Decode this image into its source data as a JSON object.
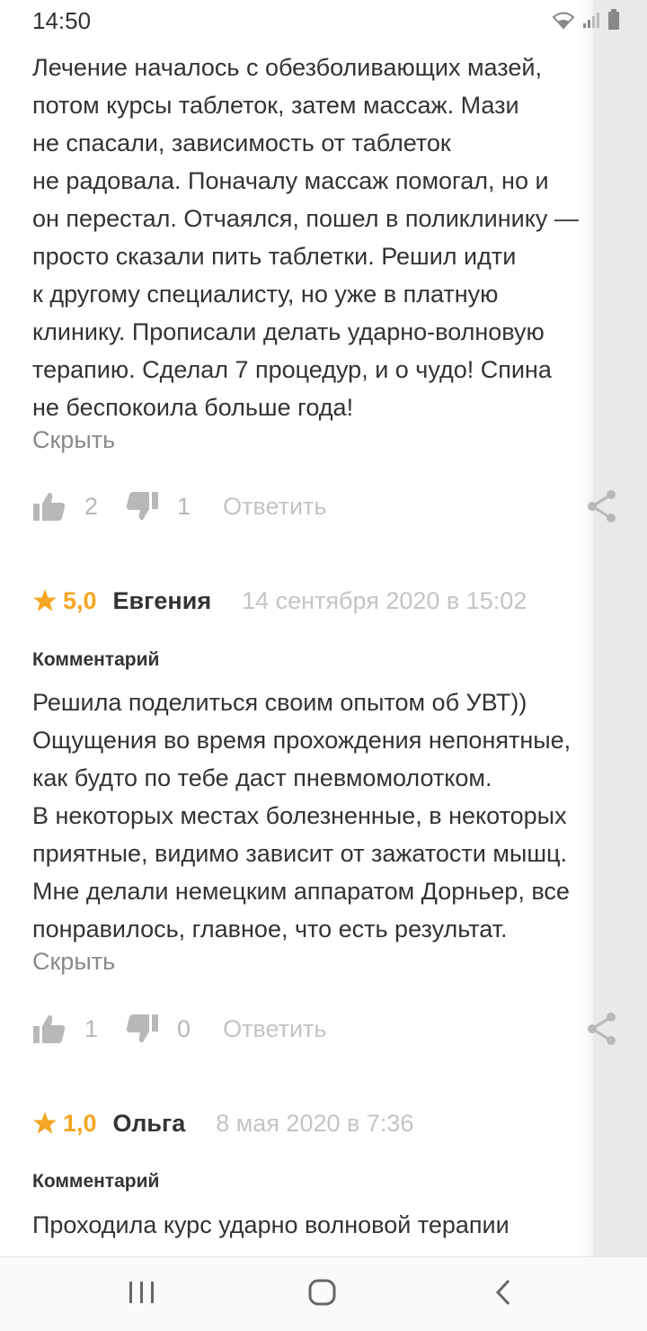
{
  "status_bar": {
    "time": "14:50"
  },
  "review1": {
    "lines": [
      "Лечение началось с обезболивающих мазей,",
      "потом курсы таблеток, затем массаж. Мази",
      "не спасали, зависимость от таблеток",
      "не радовала. Поначалу массаж помогал, но и",
      "он перестал. Отчаялся, пошел в поликлинику —",
      "просто сказали пить таблетки. Решил идти",
      "к другому специалисту, но уже в платную",
      "клинику. Прописали делать ударно-волновую",
      "терапию. Сделал 7 процедур, и о чудо! Спина",
      "не беспокоила больше года!"
    ],
    "hide_label": "Скрыть",
    "likes": "2",
    "dislikes": "1",
    "reply_label": "Ответить"
  },
  "review2": {
    "rating": "5,0",
    "author": "Евгения",
    "date": "14 сентября 2020 в 15:02",
    "section_label": "Комментарий",
    "lines": [
      "Решила поделиться своим опытом об УВТ))",
      "Ощущения во время прохождения непонятные,",
      "как будто по тебе даст пневмомолотком.",
      "В некоторых местах болезненные, в некоторых",
      "приятные, видимо зависит от зажатости мышц.",
      "Мне делали немецким аппаратом Дорньер, все",
      "понравилось, главное, что есть результат."
    ],
    "hide_label": "Скрыть",
    "likes": "1",
    "dislikes": "0",
    "reply_label": "Ответить"
  },
  "review3": {
    "rating": "1,0",
    "author": "Ольга",
    "date": "8 мая 2020 в 7:36",
    "section_label": "Комментарий",
    "lines": [
      "Проходила курс ударно волновой терапии"
    ]
  },
  "colors": {
    "rating_star": "#f5a623",
    "text": "#333333",
    "muted": "#c4c4c4",
    "icon": "#b8b8b8"
  },
  "icons": {
    "like": "thumbs-up-icon",
    "dislike": "thumbs-down-icon",
    "share": "share-icon",
    "star": "star-icon"
  }
}
